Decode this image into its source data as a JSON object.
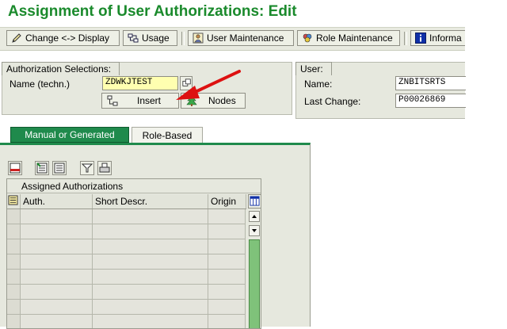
{
  "page": {
    "title": "Assignment of User Authorizations: Edit"
  },
  "toolbar": {
    "change_display": "Change <-> Display",
    "usage": "Usage",
    "user_maintenance": "User Maintenance",
    "role_maintenance": "Role Maintenance",
    "information": "Informa"
  },
  "auth_selections": {
    "title": "Authorization Selections:",
    "name_label": "Name (techn.)",
    "name_value": "ZDWKJTEST",
    "insert_label": "Insert",
    "nodes_label": "Nodes"
  },
  "user_panel": {
    "title": "User:",
    "name_label": "Name:",
    "name_value": "ZNBITSRTS",
    "last_change_label": "Last Change:",
    "last_change_value": "P00026869"
  },
  "tabs": [
    {
      "label": "Manual or Generated",
      "active": true
    },
    {
      "label": "Role-Based",
      "active": false
    }
  ],
  "assigned": {
    "title": "Assigned Authorizations",
    "columns": [
      "Auth.",
      "Short Descr.",
      "Origin"
    ],
    "rows": 8
  },
  "colors": {
    "title_green": "#1a8a2c",
    "arrow_red": "#dd1111",
    "tab_green": "#1f8a4c"
  }
}
